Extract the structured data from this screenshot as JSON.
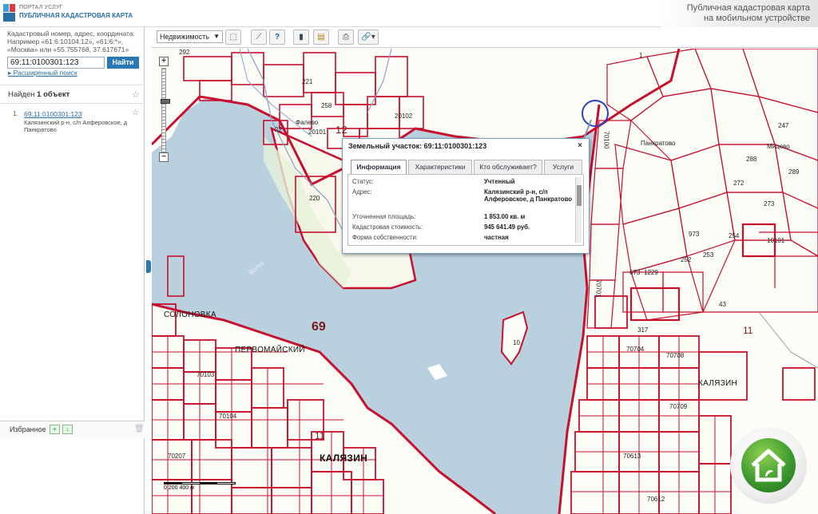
{
  "header": {
    "portal": "ПОРТАЛ УСЛУГ",
    "site": "ПУБЛИЧНАЯ КАДАСТРОВАЯ КАРТА",
    "mobile_line1": "Публичная кадастровая карта",
    "mobile_line2": "на мобильном устройстве"
  },
  "search": {
    "hint": "Кадастровый номер, адрес, координата: Например «61:6:10104:12», «61:6:*», «Москва» или «55.755768, 37.617671»",
    "value": "69:11:0100301:123",
    "button": "Найти",
    "advanced": "Расширенный поиск"
  },
  "results": {
    "title_prefix": "Найден ",
    "title_count": "1 объект",
    "items": [
      {
        "num": "1.",
        "cadastral": "69:11:0100301:123",
        "address": "Калязинский р-н, с/п Алферовское, д Панкратово"
      }
    ]
  },
  "favorites": {
    "title": "Избранное"
  },
  "toolbar": {
    "layer": "Недвижимость",
    "icons": [
      "select-icon",
      "measure-icon",
      "identify-icon",
      "layers-icon",
      "export-icon",
      "print-icon",
      "link-icon"
    ]
  },
  "popup": {
    "title": "Земельный участок: 69:11:0100301:123",
    "tabs": [
      "Информация",
      "Характеристики",
      "Кто обслуживает?",
      "Услуги"
    ],
    "rows": [
      {
        "label": "Статус:",
        "value": "Учтенный"
      },
      {
        "label": "Адрес:",
        "value": "Калязинский р-н, с/п Алферовское, д Панкратово"
      },
      {
        "label": "Уточненная площадь:",
        "value": "1 853.00 кв. м"
      },
      {
        "label": "Кадастровая стоимость:",
        "value": "945 641.49 руб."
      },
      {
        "label": "Форма собственности:",
        "value": "частная"
      }
    ]
  },
  "map": {
    "labels": {
      "n292": "292",
      "n221": "221",
      "n258": "258",
      "n22": "22",
      "n20102": "20102",
      "n20101": "20101",
      "n12": "12",
      "n220": "220",
      "falevo": "Фалево",
      "n69": "69",
      "solonovka": "СОЛОНОВКА",
      "pervomaisky": "ПЕРВОМАЙСКИЙ",
      "n11a": "11",
      "kalyazin_a": "КАЛЯЗИН",
      "n10": "10",
      "volga": "Волга",
      "n1": "1",
      "pankratovo": "Панкратово",
      "n288": "288",
      "n289": "289",
      "n272": "272",
      "n273": "273",
      "n254": "254",
      "n252": "252",
      "n253": "253",
      "n973": "973",
      "n43": "43",
      "n11b": "11",
      "n317": "317",
      "n70708": "70708",
      "n70709": "70709",
      "kalyazin_b": "КАЛЯЗИН",
      "n70704": "70704",
      "n70103": "70103",
      "n70104": "70104",
      "n70207": "70207",
      "n70613": "70613",
      "n70612": "70612",
      "n70701": "70701",
      "n70100": "70100",
      "n10101": "10101",
      "n673": "673",
      "n1229": "1229",
      "mitsevo": "Мицево",
      "n247": "247"
    },
    "scale": "0  200  400 м"
  },
  "colors": {
    "accent": "#2a77b5",
    "parcel": "#c8102e",
    "water": "#b9d0df",
    "land": "#fdfdf8"
  }
}
